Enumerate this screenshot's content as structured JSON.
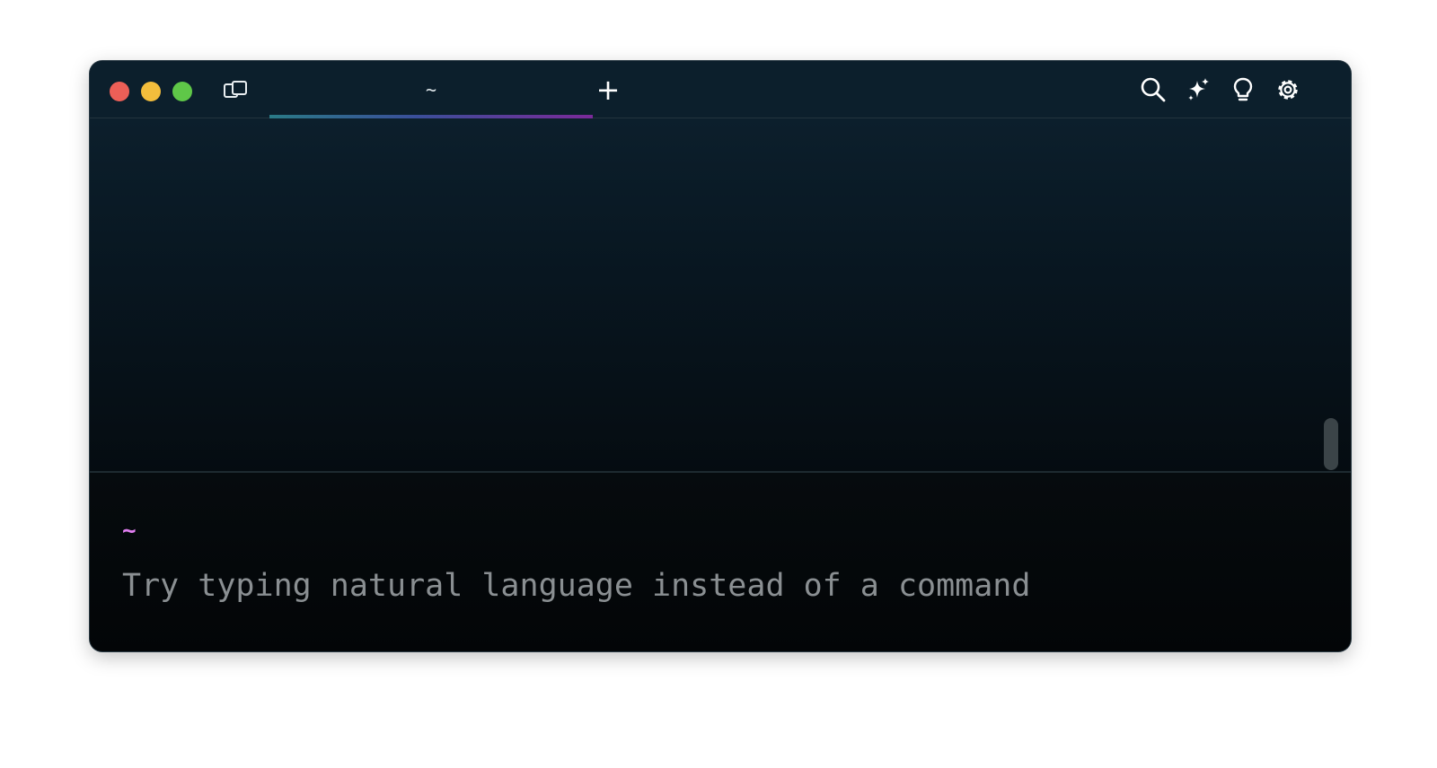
{
  "window": {
    "tab_label": "~",
    "new_tab_glyph": "+",
    "icons": {
      "tabs": "tabs-panel-icon",
      "search": "search-icon",
      "ai": "sparkle-icon",
      "tips": "lightbulb-icon",
      "settings": "gear-icon"
    }
  },
  "prompt": {
    "directory": "~",
    "placeholder": "Try typing natural language instead of a command"
  },
  "colors": {
    "titlebar_bg": "#0c1f2c",
    "terminal_bg": "#050a0e",
    "prompt_dir": "#e07ef0",
    "placeholder": "#8a8f92",
    "close": "#ec5f57",
    "minimize": "#f3bd3c",
    "zoom": "#5fc748"
  }
}
